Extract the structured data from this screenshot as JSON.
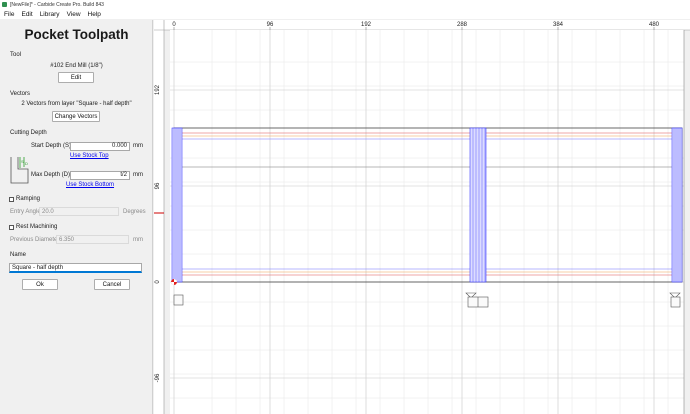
{
  "window": {
    "title": "[NewFile]* - Carbide Create Pro. Build 843"
  },
  "menu": [
    "File",
    "Edit",
    "Library",
    "View",
    "Help"
  ],
  "panel": {
    "heading": "Pocket Toolpath",
    "tool": {
      "label": "Tool",
      "name": "#102 End Mill (1/8\")",
      "edit_button": "Edit"
    },
    "vectors": {
      "label": "Vectors",
      "summary": "2 Vectors from layer \"Square - half depth\"",
      "change_button": "Change Vectors"
    },
    "cutting_depth": {
      "label": "Cutting Depth",
      "start_label": "Start Depth (S)",
      "start_value": "0.000",
      "start_unit": "mm",
      "use_stock_top": "Use Stock Top",
      "max_label": "Max Depth (D)",
      "max_value": "t/2",
      "max_unit": "mm",
      "use_stock_bottom": "Use Stock Bottom"
    },
    "ramping": {
      "label": "Ramping",
      "entry_angle_label": "Entry Angle",
      "entry_angle_value": "20.0",
      "entry_angle_unit": "Degrees"
    },
    "rest_machining": {
      "label": "Rest Machining",
      "prev_diameter_label": "Previous Diameter",
      "prev_diameter_value": "6.350",
      "prev_diameter_unit": "mm"
    },
    "name": {
      "label": "Name",
      "value": "Square - half depth"
    },
    "ok_button": "Ok",
    "cancel_button": "Cancel"
  },
  "canvas": {
    "x_ticks": [
      "0",
      "96",
      "192",
      "288",
      "384",
      "480"
    ],
    "y_ticks": [
      "192",
      "96",
      "0",
      "-96"
    ]
  },
  "colors": {
    "accent": "#0078d4",
    "link": "#0000ee",
    "toolpath_blue": "#3b3bff",
    "stock_orange": "#f0a050",
    "stock_red": "#e05050",
    "origin_red": "#e02020"
  }
}
